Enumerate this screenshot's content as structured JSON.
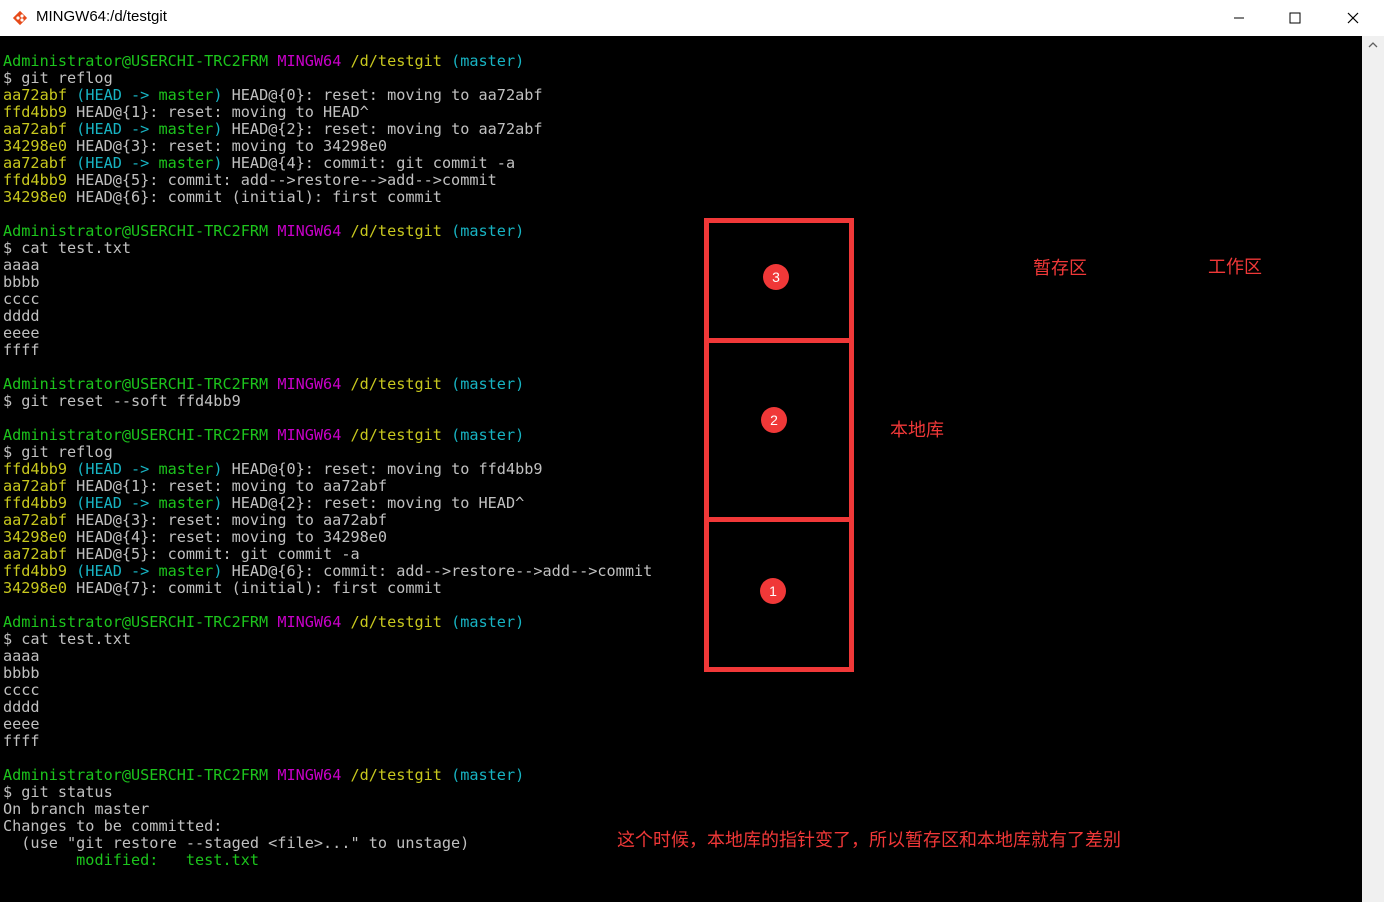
{
  "window": {
    "title": "MINGW64:/d/testgit",
    "icon": "git-bash-icon",
    "controls": [
      "minimize-icon",
      "maximize-icon",
      "close-icon"
    ]
  },
  "prompt": {
    "user": "Administrator@USERCHI-TRC2FRM",
    "system": "MINGW64",
    "path": "/d/testgit",
    "branch": "(master)"
  },
  "terminal_lines": [
    [
      {
        "t": "Administrator@USERCHI-TRC2FRM",
        "c": "g"
      },
      {
        "t": " "
      },
      {
        "t": "MINGW64",
        "c": "m"
      },
      {
        "t": " "
      },
      {
        "t": "/d/testgit",
        "c": "y"
      },
      {
        "t": " "
      },
      {
        "t": "(master)",
        "c": "c"
      }
    ],
    [
      {
        "t": "$ git reflog"
      }
    ],
    [
      {
        "t": "aa72abf",
        "c": "y"
      },
      {
        "t": " "
      },
      {
        "t": "(HEAD -> ",
        "c": "c"
      },
      {
        "t": "master",
        "c": "g"
      },
      {
        "t": ")",
        "c": "c"
      },
      {
        "t": " HEAD@{0}: reset: moving to aa72abf"
      }
    ],
    [
      {
        "t": "ffd4bb9",
        "c": "y"
      },
      {
        "t": " HEAD@{1}: reset: moving to HEAD^"
      }
    ],
    [
      {
        "t": "aa72abf",
        "c": "y"
      },
      {
        "t": " "
      },
      {
        "t": "(HEAD -> ",
        "c": "c"
      },
      {
        "t": "master",
        "c": "g"
      },
      {
        "t": ")",
        "c": "c"
      },
      {
        "t": " HEAD@{2}: reset: moving to aa72abf"
      }
    ],
    [
      {
        "t": "34298e0",
        "c": "y"
      },
      {
        "t": " HEAD@{3}: reset: moving to 34298e0"
      }
    ],
    [
      {
        "t": "aa72abf",
        "c": "y"
      },
      {
        "t": " "
      },
      {
        "t": "(HEAD -> ",
        "c": "c"
      },
      {
        "t": "master",
        "c": "g"
      },
      {
        "t": ")",
        "c": "c"
      },
      {
        "t": " HEAD@{4}: commit: git commit -a"
      }
    ],
    [
      {
        "t": "ffd4bb9",
        "c": "y"
      },
      {
        "t": " HEAD@{5}: commit: add-->restore-->add-->commit"
      }
    ],
    [
      {
        "t": "34298e0",
        "c": "y"
      },
      {
        "t": " HEAD@{6}: commit (initial): first commit"
      }
    ],
    [
      {
        "t": ""
      }
    ],
    [
      {
        "t": "Administrator@USERCHI-TRC2FRM",
        "c": "g"
      },
      {
        "t": " "
      },
      {
        "t": "MINGW64",
        "c": "m"
      },
      {
        "t": " "
      },
      {
        "t": "/d/testgit",
        "c": "y"
      },
      {
        "t": " "
      },
      {
        "t": "(master)",
        "c": "c"
      }
    ],
    [
      {
        "t": "$ cat test.txt"
      }
    ],
    [
      {
        "t": "aaaa"
      }
    ],
    [
      {
        "t": "bbbb"
      }
    ],
    [
      {
        "t": "cccc"
      }
    ],
    [
      {
        "t": "dddd"
      }
    ],
    [
      {
        "t": "eeee"
      }
    ],
    [
      {
        "t": "ffff"
      }
    ],
    [
      {
        "t": ""
      }
    ],
    [
      {
        "t": "Administrator@USERCHI-TRC2FRM",
        "c": "g"
      },
      {
        "t": " "
      },
      {
        "t": "MINGW64",
        "c": "m"
      },
      {
        "t": " "
      },
      {
        "t": "/d/testgit",
        "c": "y"
      },
      {
        "t": " "
      },
      {
        "t": "(master)",
        "c": "c"
      }
    ],
    [
      {
        "t": "$ git reset --soft ffd4bb9"
      }
    ],
    [
      {
        "t": ""
      }
    ],
    [
      {
        "t": "Administrator@USERCHI-TRC2FRM",
        "c": "g"
      },
      {
        "t": " "
      },
      {
        "t": "MINGW64",
        "c": "m"
      },
      {
        "t": " "
      },
      {
        "t": "/d/testgit",
        "c": "y"
      },
      {
        "t": " "
      },
      {
        "t": "(master)",
        "c": "c"
      }
    ],
    [
      {
        "t": "$ git reflog"
      }
    ],
    [
      {
        "t": "ffd4bb9",
        "c": "y"
      },
      {
        "t": " "
      },
      {
        "t": "(HEAD -> ",
        "c": "c"
      },
      {
        "t": "master",
        "c": "g"
      },
      {
        "t": ")",
        "c": "c"
      },
      {
        "t": " HEAD@{0}: reset: moving to ffd4bb9"
      }
    ],
    [
      {
        "t": "aa72abf",
        "c": "y"
      },
      {
        "t": " HEAD@{1}: reset: moving to aa72abf"
      }
    ],
    [
      {
        "t": "ffd4bb9",
        "c": "y"
      },
      {
        "t": " "
      },
      {
        "t": "(HEAD -> ",
        "c": "c"
      },
      {
        "t": "master",
        "c": "g"
      },
      {
        "t": ")",
        "c": "c"
      },
      {
        "t": " HEAD@{2}: reset: moving to HEAD^"
      }
    ],
    [
      {
        "t": "aa72abf",
        "c": "y"
      },
      {
        "t": " HEAD@{3}: reset: moving to aa72abf"
      }
    ],
    [
      {
        "t": "34298e0",
        "c": "y"
      },
      {
        "t": " HEAD@{4}: reset: moving to 34298e0"
      }
    ],
    [
      {
        "t": "aa72abf",
        "c": "y"
      },
      {
        "t": " HEAD@{5}: commit: git commit -a"
      }
    ],
    [
      {
        "t": "ffd4bb9",
        "c": "y"
      },
      {
        "t": " "
      },
      {
        "t": "(HEAD -> ",
        "c": "c"
      },
      {
        "t": "master",
        "c": "g"
      },
      {
        "t": ")",
        "c": "c"
      },
      {
        "t": " HEAD@{6}: commit: add-->restore-->add-->commit"
      }
    ],
    [
      {
        "t": "34298e0",
        "c": "y"
      },
      {
        "t": " HEAD@{7}: commit (initial): first commit"
      }
    ],
    [
      {
        "t": ""
      }
    ],
    [
      {
        "t": "Administrator@USERCHI-TRC2FRM",
        "c": "g"
      },
      {
        "t": " "
      },
      {
        "t": "MINGW64",
        "c": "m"
      },
      {
        "t": " "
      },
      {
        "t": "/d/testgit",
        "c": "y"
      },
      {
        "t": " "
      },
      {
        "t": "(master)",
        "c": "c"
      }
    ],
    [
      {
        "t": "$ cat test.txt"
      }
    ],
    [
      {
        "t": "aaaa"
      }
    ],
    [
      {
        "t": "bbbb"
      }
    ],
    [
      {
        "t": "cccc"
      }
    ],
    [
      {
        "t": "dddd"
      }
    ],
    [
      {
        "t": "eeee"
      }
    ],
    [
      {
        "t": "ffff"
      }
    ],
    [
      {
        "t": ""
      }
    ],
    [
      {
        "t": "Administrator@USERCHI-TRC2FRM",
        "c": "g"
      },
      {
        "t": " "
      },
      {
        "t": "MINGW64",
        "c": "m"
      },
      {
        "t": " "
      },
      {
        "t": "/d/testgit",
        "c": "y"
      },
      {
        "t": " "
      },
      {
        "t": "(master)",
        "c": "c"
      }
    ],
    [
      {
        "t": "$ git status"
      }
    ],
    [
      {
        "t": "On branch master"
      }
    ],
    [
      {
        "t": "Changes to be committed:"
      }
    ],
    [
      {
        "t": "  (use \"git restore --staged <file>...\" to unstage)"
      }
    ],
    [
      {
        "t": "        "
      },
      {
        "t": "modified:   test.txt",
        "c": "g"
      }
    ]
  ],
  "annotations": {
    "badge_1": "1",
    "badge_2": "2",
    "badge_3": "3",
    "label_staging": "暂存区",
    "label_workspace": "工作区",
    "label_local_repo": "本地库",
    "note": "这个时候，本地库的指针变了，所以暂存区和本地库就有了差别",
    "annotation_color": "#f03838"
  },
  "colors": {
    "prompt_user": "#1cc41c",
    "prompt_system": "#c800c8",
    "prompt_path": "#c8c81e",
    "prompt_branch": "#17b3c2",
    "text": "#c0c0c0",
    "background": "#000000"
  }
}
